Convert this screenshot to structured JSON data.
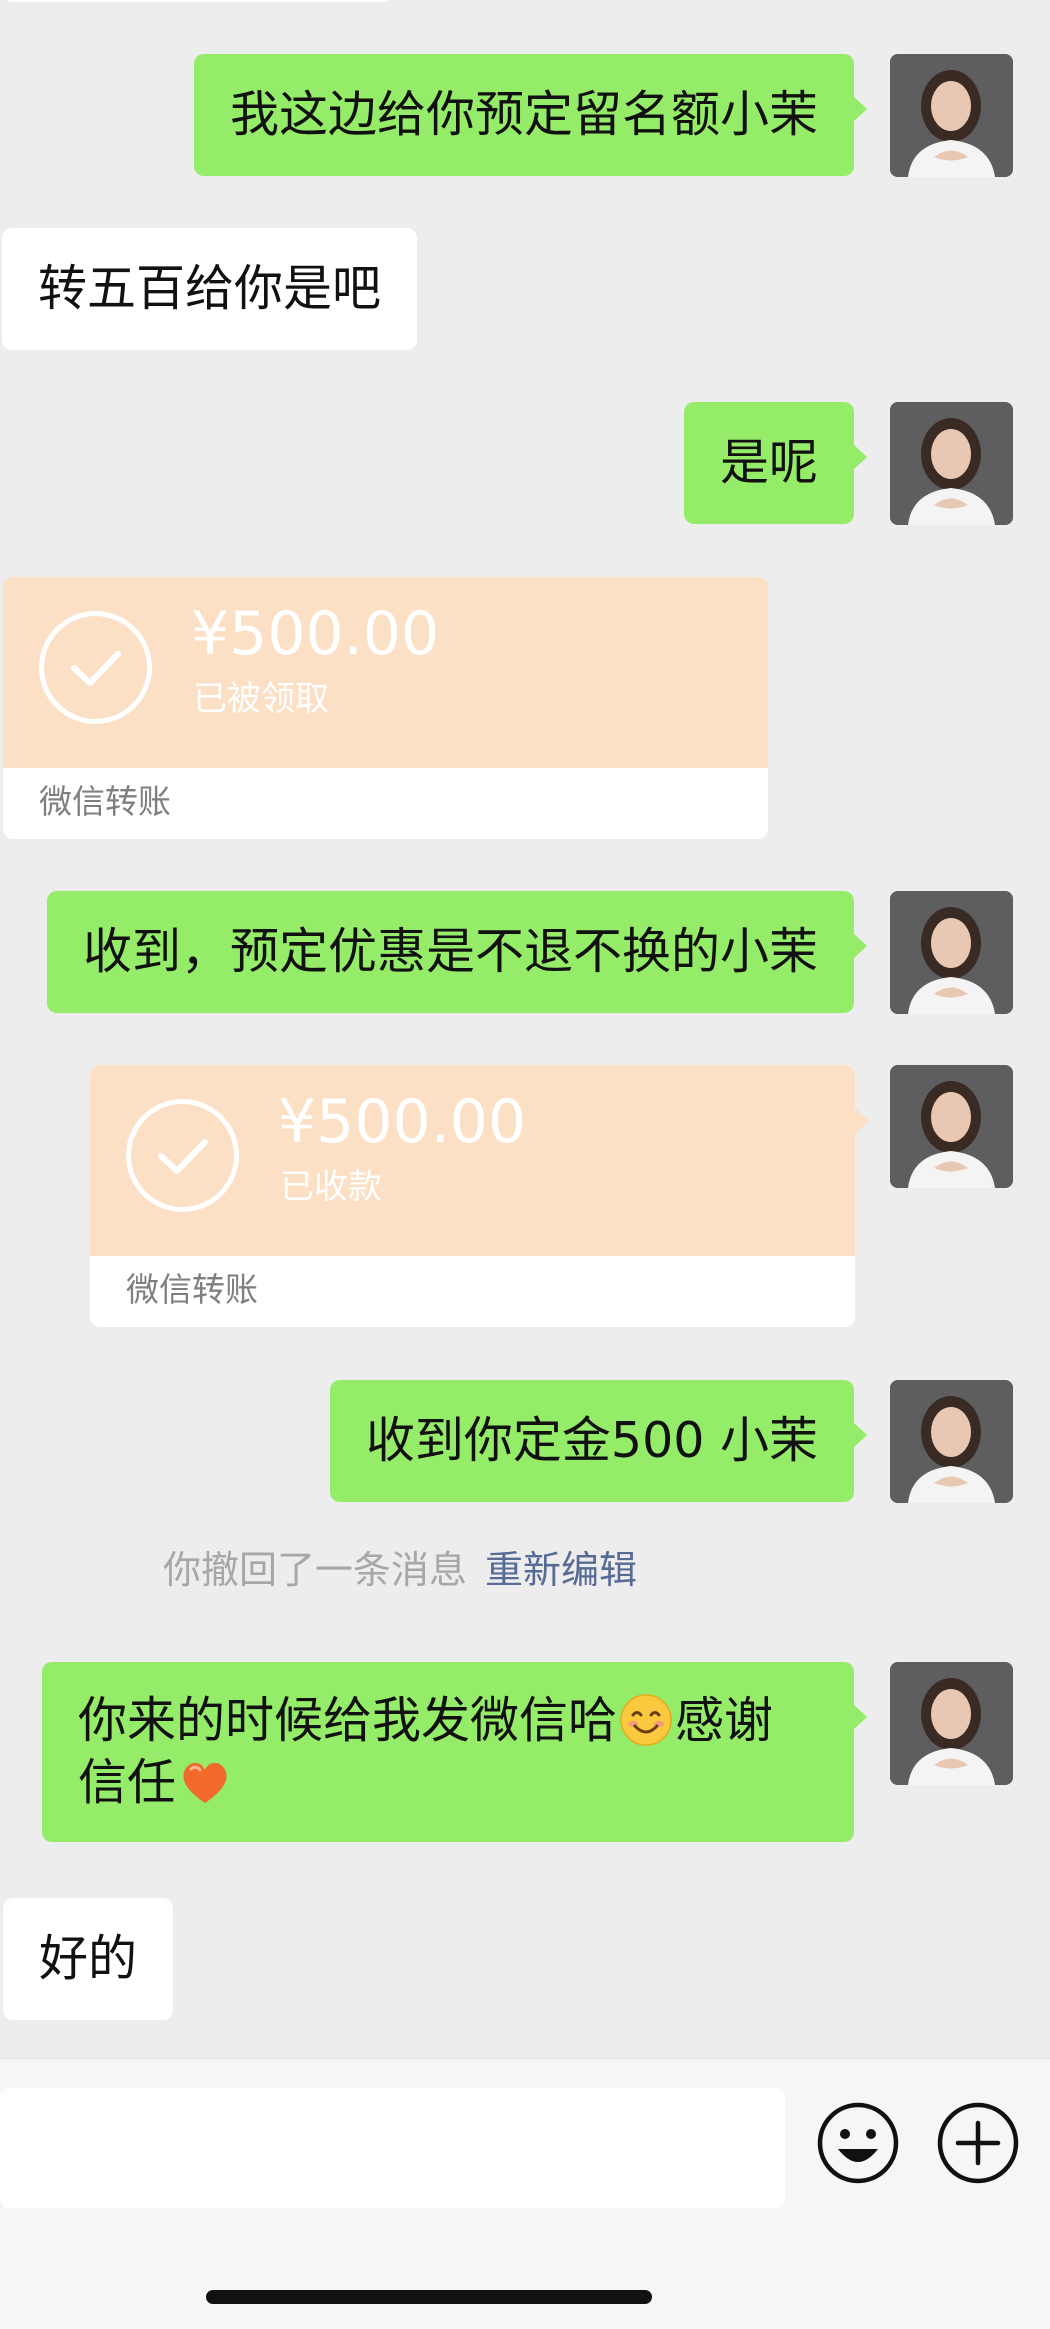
{
  "chat": {
    "messages": [
      {
        "sender": "me",
        "type": "text",
        "text": "我这边给你预定留名额小茉"
      },
      {
        "sender": "them",
        "type": "text",
        "text": "转五百给你是吧"
      },
      {
        "sender": "me",
        "type": "text",
        "text": "是呢"
      },
      {
        "sender": "them",
        "type": "transfer",
        "amount": "¥500.00",
        "status": "已被领取",
        "footer": "微信转账"
      },
      {
        "sender": "me",
        "type": "text",
        "text": "收到，预定优惠是不退不换的小茉"
      },
      {
        "sender": "me",
        "type": "transfer",
        "amount": "¥500.00",
        "status": "已收款",
        "footer": "微信转账"
      },
      {
        "sender": "me",
        "type": "text",
        "text": "收到你定金500 小茉"
      },
      {
        "sender": "system",
        "type": "recall",
        "text": "你撤回了一条消息",
        "action": "重新编辑"
      },
      {
        "sender": "me",
        "type": "text",
        "text_part1": "你来的时候给我发微信哈",
        "emoji1": "smiling-face-emoji",
        "text_part2": "感谢信任",
        "emoji2": "orange-heart-emoji"
      },
      {
        "sender": "them",
        "type": "text",
        "text": "好的"
      }
    ]
  },
  "input_bar": {
    "emoji_button_icon": "smiley-face-icon",
    "plus_button_icon": "plus-circle-icon"
  },
  "colors": {
    "background": "#ededed",
    "my_bubble": "#95ec69",
    "their_bubble": "#ffffff",
    "transfer_card": "#fbe0c6",
    "link": "#576b95",
    "system_text": "#a7a7a7"
  }
}
